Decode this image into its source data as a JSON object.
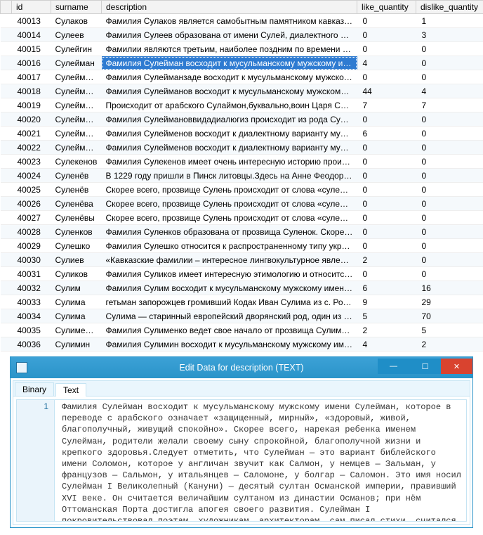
{
  "columns": {
    "id": "id",
    "surname": "surname",
    "description": "description",
    "like": "like_quantity",
    "dislike": "dislike_quantity"
  },
  "selected_row": 3,
  "rows": [
    {
      "id": "40013",
      "surname": "Сулаков",
      "desc": "Фамилия Сулаков является самобытным памятником кавказской ку…",
      "like": "0",
      "dislike": "1"
    },
    {
      "id": "40014",
      "surname": "Сулеев",
      "desc": "Фамилия Сулеев образована от имени Сулей, диалектного вариант…",
      "like": "0",
      "dislike": "3"
    },
    {
      "id": "40015",
      "surname": "Сулейгин",
      "desc": "Фамилии являются третьим, наиболее поздним по времени возникн…",
      "like": "0",
      "dislike": "0"
    },
    {
      "id": "40016",
      "surname": "Сулейман",
      "desc": "Фамилия Сулейман восходит к мусульманскому мужскому имени Су…",
      "like": "4",
      "dislike": "0"
    },
    {
      "id": "40017",
      "surname": "Сулейман…",
      "desc": "Фамилия Сулейманзаде восходит к мусульманскому мужскому имен…",
      "like": "0",
      "dislike": "0"
    },
    {
      "id": "40018",
      "surname": "Сулейманов",
      "desc": "Фамилия Сулейманов восходит к мусульманскому мужскому имени …",
      "like": "44",
      "dislike": "4"
    },
    {
      "id": "40019",
      "surname": "Сулейманов",
      "desc": "Происходит от арабского Сулаймон,буквально,воин Царя Соломона",
      "like": "7",
      "dislike": "7"
    },
    {
      "id": "40020",
      "surname": "Сулейман…",
      "desc": "Фамилия Сулеймановвидадиалюгиз происходит из рода Сулейман…",
      "like": "0",
      "dislike": "0"
    },
    {
      "id": "40021",
      "surname": "Сулейменов",
      "desc": "Фамилия Сулейменов восходит к диалектному варианту мусульман…",
      "like": "6",
      "dislike": "0"
    },
    {
      "id": "40022",
      "surname": "Сулейменов",
      "desc": "Фамилия Сулейменов восходит к диалектному варианту мусульман…",
      "like": "0",
      "dislike": "0"
    },
    {
      "id": "40023",
      "surname": "Сулекенов",
      "desc": "Фамилия Сулекенов имеет очень интересную историю происхожде…",
      "like": "0",
      "dislike": "0"
    },
    {
      "id": "40024",
      "surname": "Суленёв",
      "desc": "В 1229 году пришли в Пинск литовцы.Здесь на Анне Феодоровне ж…",
      "like": "0",
      "dislike": "0"
    },
    {
      "id": "40025",
      "surname": "Суленёв",
      "desc": "Скорее всего, прозвище Сулень происходит от слова «суленковый…",
      "like": "0",
      "dislike": "0"
    },
    {
      "id": "40026",
      "surname": "Суленёва",
      "desc": "Скорее всего, прозвище Сулень происходит от слова «суленковый…",
      "like": "0",
      "dislike": "0"
    },
    {
      "id": "40027",
      "surname": "Суленёвы",
      "desc": "Скорее всего, прозвище Сулень происходит от слова «суленковый…",
      "like": "0",
      "dislike": "0"
    },
    {
      "id": "40028",
      "surname": "Суленков",
      "desc": "Фамилия Суленков образована от прозвища Суленок. Скорее всего…",
      "like": "0",
      "dislike": "0"
    },
    {
      "id": "40029",
      "surname": "Сулешко",
      "desc": "Фамилия Сулешко относится к распространенному типу украински…",
      "like": "0",
      "dislike": "0"
    },
    {
      "id": "40030",
      "surname": "Сулиев",
      "desc": "«Кавказские фамилии – интересное лингвокультурное явление. Нац…",
      "like": "2",
      "dislike": "0"
    },
    {
      "id": "40031",
      "surname": "Суликов",
      "desc": "Фамилия Суликов имеет интересную этимологию и относится к гру…",
      "like": "0",
      "dislike": "0"
    },
    {
      "id": "40032",
      "surname": "Сулим",
      "desc": "Фамилия Сулим восходит к мусульманскому мужскому имени Сулим…",
      "like": "6",
      "dislike": "16"
    },
    {
      "id": "40033",
      "surname": "Сулима",
      "desc": "гетьман запорожцев громивший Кодак Иван Сулима из с. Рогоща Ч…",
      "like": "9",
      "dislike": "29"
    },
    {
      "id": "40034",
      "surname": "Сулима",
      "desc": "Сулима — старинный европейский дворянский род, один из предко…",
      "like": "5",
      "dislike": "70"
    },
    {
      "id": "40035",
      "surname": "Сулименко",
      "desc": "Фамилия Сулименко ведет свое начало от прозвища Сулима. Фами…",
      "like": "2",
      "dislike": "5"
    },
    {
      "id": "40036",
      "surname": "Сулимин",
      "desc": "Фамилия Сулимин восходит к мусульманскому мужскому имени Сул…",
      "like": "4",
      "dislike": "2"
    }
  ],
  "dialog": {
    "title": "Edit Data for description (TEXT)",
    "tabs": {
      "binary": "Binary",
      "text": "Text"
    },
    "line_no": "1",
    "text": "Фамилия Сулейман восходит к мусульманскому мужскому имени Сулейман, которое в переводе с арабского означает «защищенный, мирный», «здоровый, живой, благополучный, живущий спокойно». Скорее всего, нарекая ребенка именем Сулейман, родители желали своему сыну спрокойной, благополучной жизни и крепкого здоровья.Следует отметить, что Сулейман — это вариант библейского имени Соломон, которое у англичан звучит как Салмон, у немцев — Зальман, у французов — Сальмон, у итальянцев — Саломоне, у болгар — Саломон. Это имя носил Сулейман I Великолепный (Кануни) — десятый султан Османской империи, правивший XVI веке. Он считается величайшим султаном из династии Османов; при нём Оттоманская Порта достигла апогея своего развития. Сулейман I покровительствовал поэтам, художникам, архитекторам, сам писал стихи, считался умелым кузнецом. Он завоевал расположение народа добрыми делами, отпускал насильно выведенных ремесленников и строил новые школы."
  }
}
